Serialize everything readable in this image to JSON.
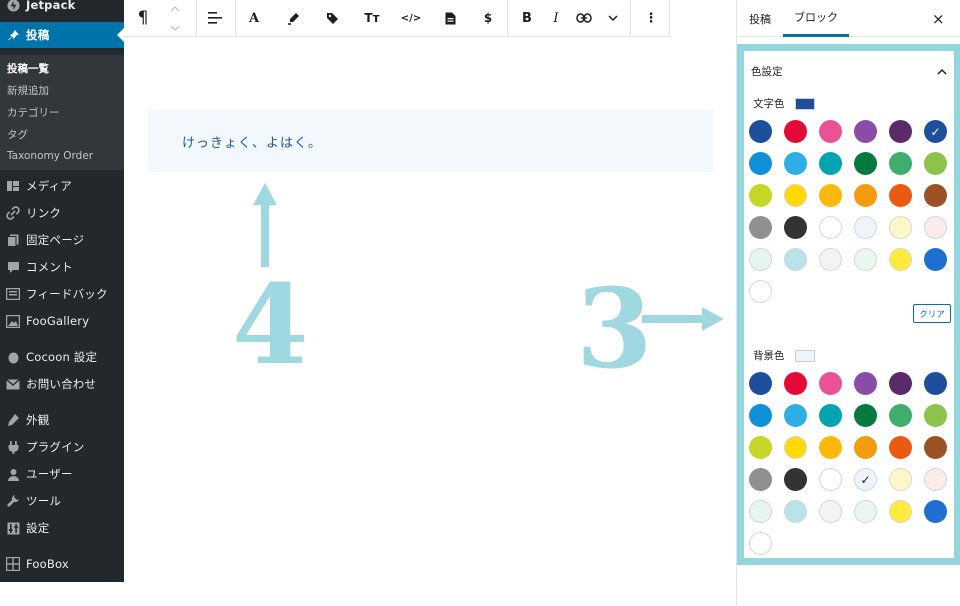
{
  "sidebar": {
    "top_item": "Jetpack",
    "active_item": "投稿",
    "submenu": [
      "投稿一覧",
      "新規追加",
      "カテゴリー",
      "タグ",
      "Taxonomy Order"
    ],
    "items": [
      {
        "label": "メディア",
        "icon": "media-icon"
      },
      {
        "label": "リンク",
        "icon": "link-icon"
      },
      {
        "label": "固定ページ",
        "icon": "page-icon"
      },
      {
        "label": "コメント",
        "icon": "comment-icon"
      },
      {
        "label": "フィードバック",
        "icon": "feedback-icon"
      },
      {
        "label": "FooGallery",
        "icon": "gallery-icon"
      },
      {
        "label": "Cocoon 設定",
        "icon": "cocoon-icon"
      },
      {
        "label": "お問い合わせ",
        "icon": "mail-icon"
      },
      {
        "label": "外観",
        "icon": "appearance-icon"
      },
      {
        "label": "プラグイン",
        "icon": "plugin-icon"
      },
      {
        "label": "ユーザー",
        "icon": "user-icon"
      },
      {
        "label": "ツール",
        "icon": "tool-icon"
      },
      {
        "label": "設定",
        "icon": "settings-icon"
      },
      {
        "label": "FooBox",
        "icon": "foobox-icon"
      }
    ]
  },
  "toolbar": {
    "paragraph_glyph": "¶",
    "align_glyph": "≡",
    "text_glyph": "A",
    "tt_glyph": "Tт",
    "code_glyph": "</>",
    "dollar_glyph": "$",
    "bold_glyph": "B",
    "italic_glyph": "I",
    "more_glyph": "⋮"
  },
  "editor": {
    "block_text": "けっきょく、よはく。"
  },
  "annotations": {
    "number_a": "4",
    "number_b": "3",
    "color": "#9fd8e0"
  },
  "settings": {
    "tab_post": "投稿",
    "tab_block": "ブロック",
    "close": "×",
    "panel_title": "色設定",
    "text_color_label": "文字色",
    "bg_color_label": "背景色",
    "clear_label": "クリア",
    "text_color_value": "#1e4f9c",
    "bg_color_value": "#eef5fa",
    "palette": [
      "#1e4f9c",
      "#e50a36",
      "#e95295",
      "#8a4da7",
      "#5b2a6b",
      "#1e4f9c",
      "#0f90d8",
      "#2fade6",
      "#00a3af",
      "#047a3e",
      "#3dae6b",
      "#8dc34c",
      "#c6d626",
      "#ffd900",
      "#fdb80c",
      "#f49b0f",
      "#ea5a11",
      "#9b5326",
      "#909090",
      "#333333",
      "#ffffff",
      "#eef5fa",
      "#fff7c9",
      "#fbecec",
      "#e6f5f2",
      "#b9e2e9",
      "#f3f3f3",
      "#eaf6ee",
      "#ffeb3b",
      "#1e6fd1",
      "#ffffff"
    ],
    "text_selected_index": 5,
    "bg_selected_index": 21
  }
}
